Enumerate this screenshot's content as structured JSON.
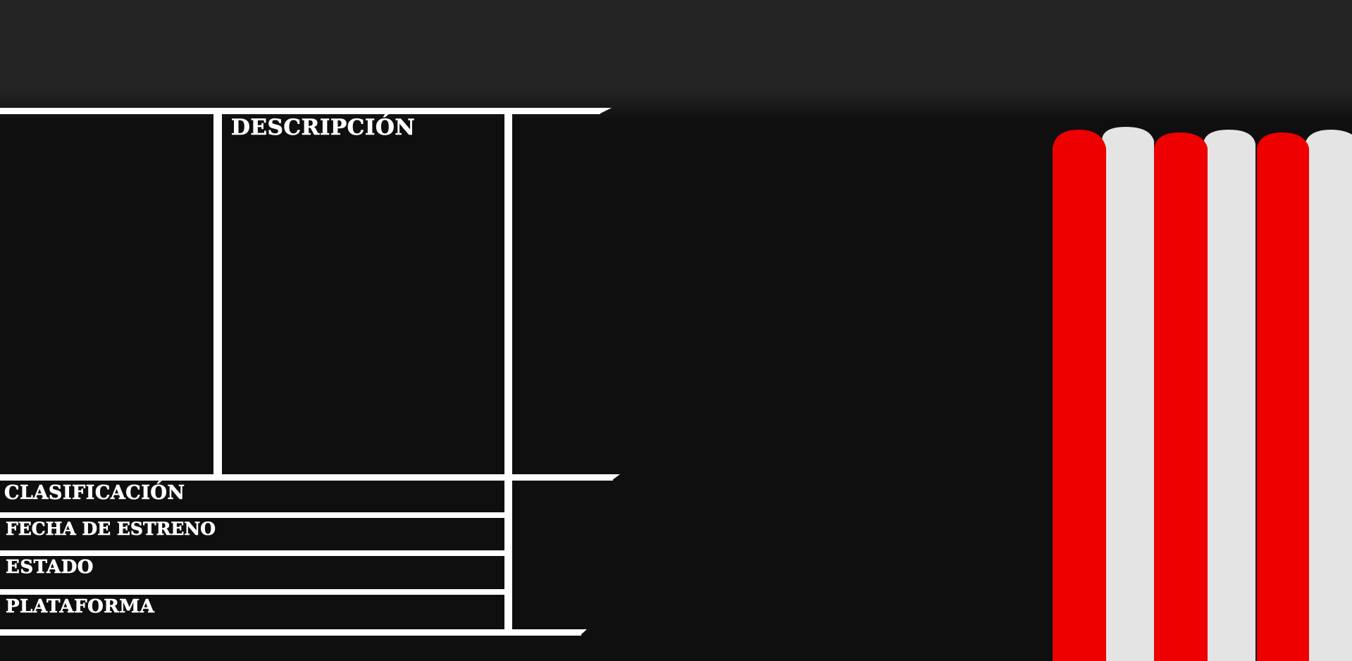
{
  "panel": {
    "description_label": "DESCRIPCIÓN",
    "fields": [
      {
        "key": "classification",
        "label": "CLASIFICACIÓN"
      },
      {
        "key": "release_date",
        "label": "FECHA DE ESTRENO"
      },
      {
        "key": "status",
        "label": "ESTADO"
      },
      {
        "key": "platform",
        "label": "PLATAFORMA"
      }
    ]
  },
  "colors": {
    "background": "#0f0f0f",
    "header": "#232323",
    "lines": "#ffffff",
    "curtain_red": "#ee0000",
    "curtain_white": "#e4e4e4"
  }
}
